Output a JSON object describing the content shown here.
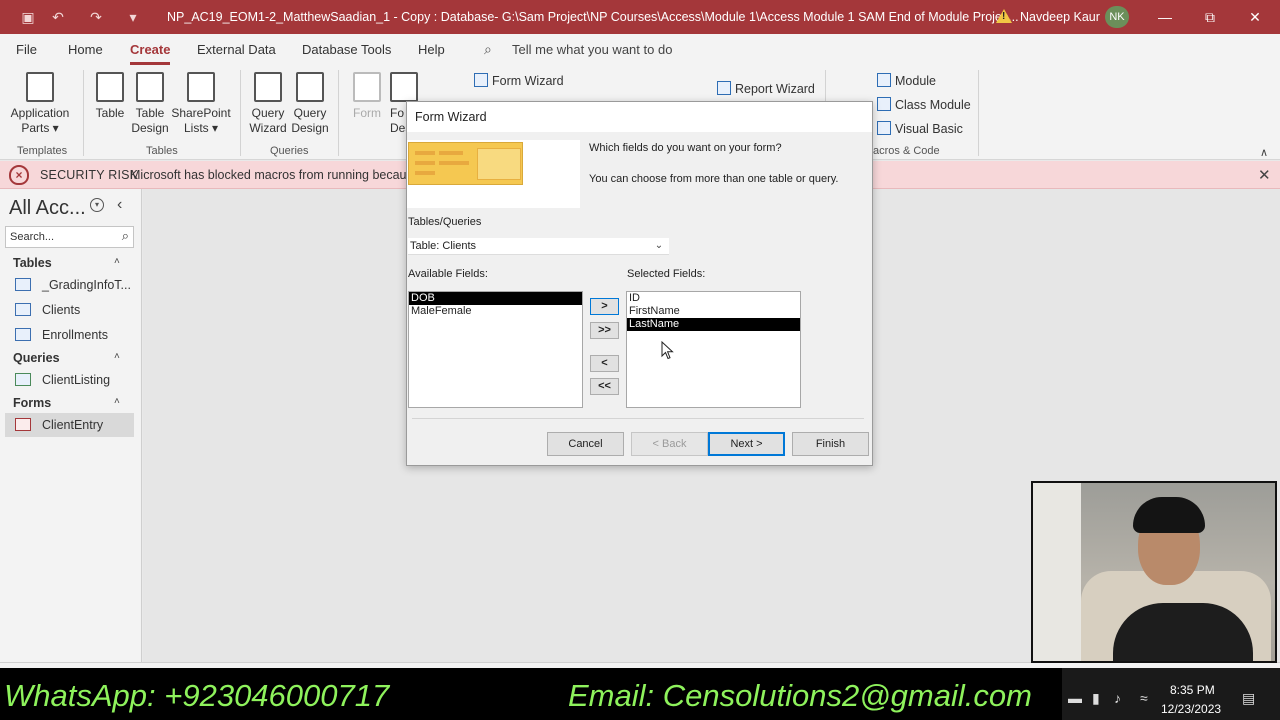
{
  "titlebar": {
    "title": "NP_AC19_EOM1-2_MatthewSaadian_1 - Copy : Database- G:\\Sam Project\\NP Courses\\Access\\Module 1\\Access Module 1 SAM End of Module Projec...",
    "warning_glyph": "!",
    "user_name": "Navdeep Kaur",
    "user_initials": "NK",
    "save_glyph": "▣",
    "undo_glyph": "↶",
    "redo_glyph": "↷",
    "customize_glyph": "▾",
    "minimize_glyph": "—",
    "restore_glyph": "⧉",
    "close_glyph": "✕"
  },
  "menu": {
    "tabs": [
      "File",
      "Home",
      "Create",
      "External Data",
      "Database Tools",
      "Help"
    ],
    "active_tab": "Create",
    "tell_me": "Tell me what you want to do",
    "search_glyph": "⌕"
  },
  "ribbon": {
    "application_parts": "Application",
    "application_parts_2": "Parts ▾",
    "table": "Table",
    "table_design_1": "Table",
    "table_design_2": "Design",
    "sharepoint_1": "SharePoint",
    "sharepoint_2": "Lists ▾",
    "query_wizard_1": "Query",
    "query_wizard_2": "Wizard",
    "query_design_1": "Query",
    "query_design_2": "Design",
    "form": "Form",
    "form_design_1": "Fo",
    "form_design_2": "Des",
    "form_wizard": "Form Wizard",
    "report_wizard": "Report Wizard",
    "module": "Module",
    "class_module": "Class Module",
    "visual_basic": "Visual Basic",
    "groups": {
      "templates": "Templates",
      "tables": "Tables",
      "queries": "Queries",
      "macros": "acros & Code"
    },
    "collapse_glyph": "∧"
  },
  "security": {
    "label": "SECURITY RISK",
    "message": "Microsoft has blocked macros from running because",
    "shield_glyph": "×",
    "close_glyph": "✕"
  },
  "nav": {
    "title": "All Acc...",
    "dropdown_glyph": "▾",
    "collapse_glyph": "‹",
    "search_placeholder": "Search...",
    "search_glyph": "⌕",
    "caret_glyph": "˄",
    "sections": {
      "tables": "Tables",
      "queries": "Queries",
      "forms": "Forms"
    },
    "tables": [
      "_GradingInfoT...",
      "Clients",
      "Enrollments"
    ],
    "queries": [
      "ClientListing"
    ],
    "forms": [
      "ClientEntry"
    ],
    "selected_item": "ClientEntry"
  },
  "dialog": {
    "title": "Form Wizard",
    "question": "Which fields do you want on your form?",
    "hint": "You can choose from more than one table or query.",
    "tables_queries_label": "Tables/Queries",
    "tables_queries_value": "Table: Clients",
    "dropdown_glyph": "⌄",
    "available_label": "Available Fields:",
    "selected_label": "Selected Fields:",
    "available_fields": [
      "DOB",
      "MaleFemale"
    ],
    "available_selected": "DOB",
    "selected_fields": [
      "ID",
      "FirstName",
      "LastName"
    ],
    "selected_selected": "LastName",
    "move_one": ">",
    "move_all": ">>",
    "remove_one": "<",
    "remove_all": "<<",
    "cancel": "Cancel",
    "back": "< Back",
    "next": "Next >",
    "finish": "Finish"
  },
  "banner": {
    "whatsapp": "WhatsApp: +923046000717",
    "email": "Email: Censolutions2@gmail.com",
    "time": "8:35 PM",
    "date": "12/23/2023",
    "tray_glyphs": [
      "▬",
      "▮",
      "♪",
      "≈",
      "▤"
    ]
  }
}
